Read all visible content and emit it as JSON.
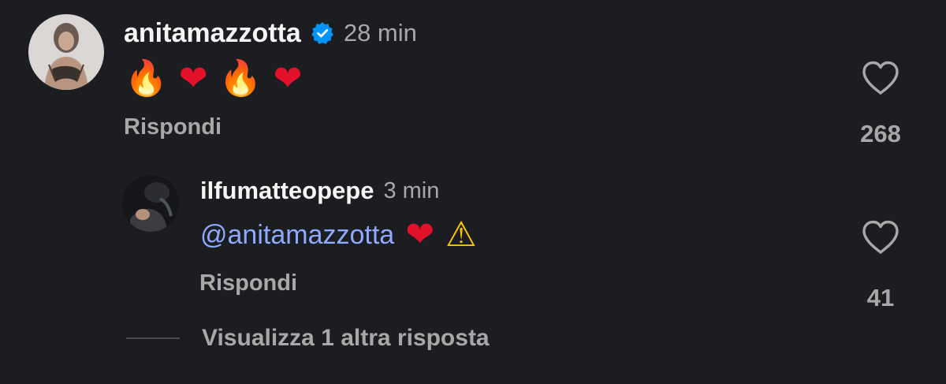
{
  "comment": {
    "username": "anitamazzotta",
    "verified_icon": "verified-badge-icon",
    "timestamp": "28 min",
    "emojis": [
      "🔥",
      "❤",
      "🔥",
      "❤"
    ],
    "reply_label": "Rispondi",
    "likes": "268"
  },
  "reply": {
    "username": "ilfumatteopepe",
    "timestamp": "3 min",
    "mention": "@anitamazzotta",
    "emojis": [
      "❤",
      "⚠"
    ],
    "reply_label": "Rispondi",
    "likes": "41"
  },
  "more_replies": {
    "label": "Visualizza 1 altra risposta"
  },
  "colors": {
    "background": "#1b1d20",
    "mention": "#8fa9ff",
    "secondary_text": "#a8a8a8",
    "verified": "#0095f6"
  }
}
